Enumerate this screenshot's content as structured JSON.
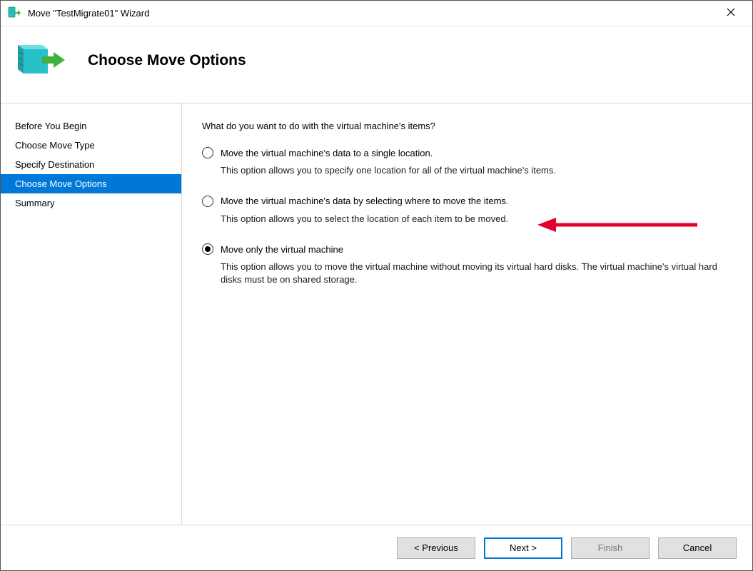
{
  "window": {
    "title": "Move \"TestMigrate01\" Wizard"
  },
  "header": {
    "page_title": "Choose Move Options"
  },
  "sidebar": {
    "steps": [
      {
        "label": "Before You Begin",
        "active": false
      },
      {
        "label": "Choose Move Type",
        "active": false
      },
      {
        "label": "Specify Destination",
        "active": false
      },
      {
        "label": "Choose Move Options",
        "active": true
      },
      {
        "label": "Summary",
        "active": false
      }
    ]
  },
  "content": {
    "prompt": "What do you want to do with the virtual machine's items?",
    "options": [
      {
        "label": "Move the virtual machine's data to a single location.",
        "description": "This option allows you to specify one location for all of the virtual machine's items.",
        "selected": false
      },
      {
        "label": "Move the virtual machine's data by selecting where to move the items.",
        "description": "This option allows you to select the location of each item to be moved.",
        "selected": false
      },
      {
        "label": "Move only the virtual machine",
        "description": "This option allows you to move the virtual machine without moving its virtual hard disks. The virtual machine's virtual hard disks must be on shared storage.",
        "selected": true
      }
    ]
  },
  "footer": {
    "previous": "< Previous",
    "next": "Next >",
    "finish": "Finish",
    "cancel": "Cancel"
  }
}
